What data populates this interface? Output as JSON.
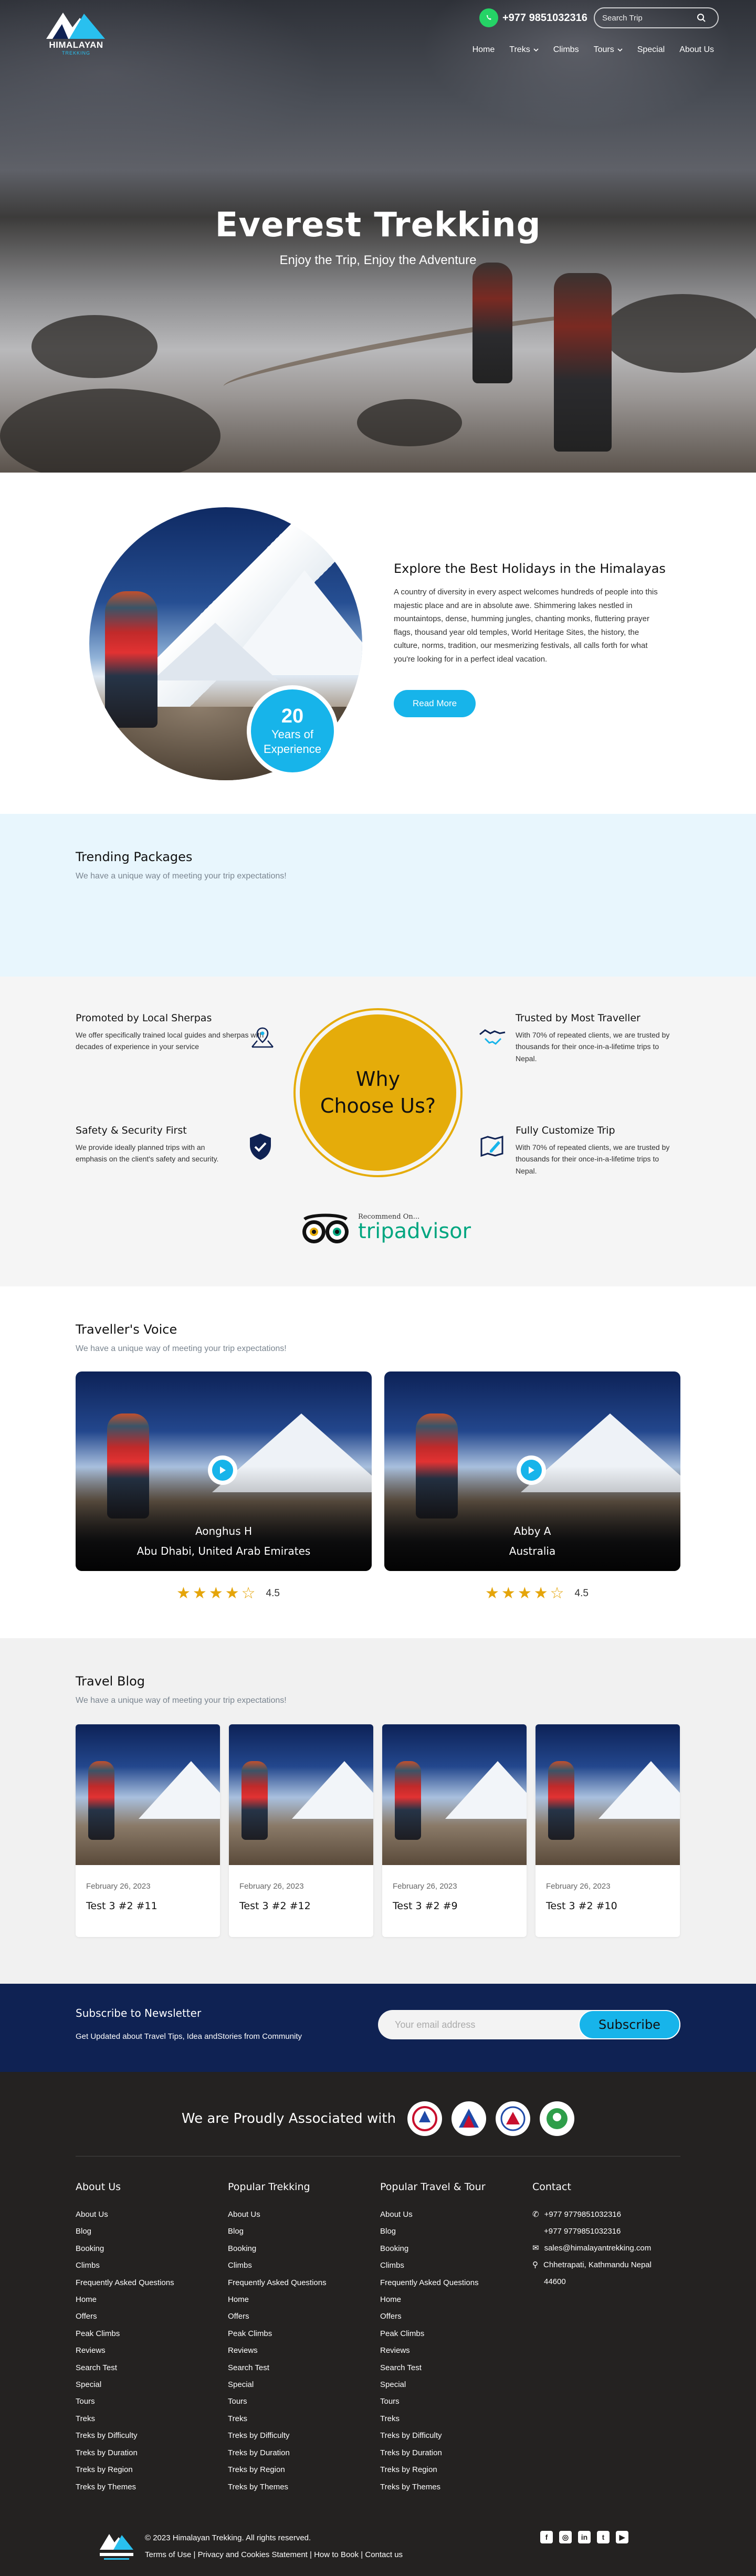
{
  "header": {
    "logo_text": "HIMALAYAN",
    "logo_sub": "TREKKING",
    "phone": "+977 9851032316",
    "search_placeholder": "Search Trip",
    "nav": [
      "Home",
      "Treks",
      "Climbs",
      "Tours",
      "Special",
      "About Us"
    ]
  },
  "hero": {
    "title": "Everest Trekking",
    "subtitle": "Enjoy the Trip, Enjoy the Adventure"
  },
  "explore": {
    "badge_number": "20",
    "badge_text_1": "Years of",
    "badge_text_2": "Experience",
    "title": "Explore the Best Holidays in the Himalayas",
    "body": "A country of diversity in every aspect welcomes hundreds of people into this majestic place and are in absolute awe. Shimmering lakes nestled in mountaintops, dense, humming jungles, chanting monks, fluttering prayer flags, thousand year old temples, World Heritage Sites, the history, the culture, norms, tradition, our mesmerizing festivals, all calls forth for what you're looking for in a perfect ideal vacation.",
    "button": "Read More"
  },
  "trending": {
    "title": "Trending Packages",
    "subtitle": "We have a unique way of meeting your trip expectations!"
  },
  "why": {
    "circle_line1": "Why",
    "circle_line2": "Choose Us?",
    "features": [
      {
        "title": "Promoted by Local Sherpas",
        "text": "We offer specifically trained local guides and sherpas with decades of experience in your service",
        "icon": "map-pin-icon"
      },
      {
        "title": "Trusted by Most Traveller",
        "text": "With 70% of repeated clients, we are trusted by thousands for their once-in-a-lifetime trips to Nepal.",
        "icon": "handshake-icon"
      },
      {
        "title": "Safety & Security First",
        "text": "We provide ideally planned trips with an emphasis on the client's safety and security.",
        "icon": "shield-check-icon"
      },
      {
        "title": "Fully Customize Trip",
        "text": "With 70% of repeated clients, we are trusted by thousands for their once-in-a-lifetime trips to Nepal.",
        "icon": "map-edit-icon"
      }
    ],
    "recommended": "Recommend On...",
    "tripadvisor": "tripadvisor"
  },
  "voice": {
    "title": "Traveller's Voice",
    "subtitle": "We have a unique way of meeting your trip expectations!",
    "cards": [
      {
        "name": "Aonghus H",
        "place": "Abu Dhabi, United Arab Emirates",
        "rating": 4.5,
        "score": "4.5"
      },
      {
        "name": "Abby A",
        "place": "Australia",
        "rating": 4.5,
        "score": "4.5"
      }
    ]
  },
  "blog": {
    "title": "Travel Blog",
    "subtitle": "We have a unique way of meeting your trip expectations!",
    "posts": [
      {
        "date": "February 26, 2023",
        "title": "Test 3 #2 #11"
      },
      {
        "date": "February 26, 2023",
        "title": "Test 3 #2 #12"
      },
      {
        "date": "February 26, 2023",
        "title": "Test 3 #2 #9"
      },
      {
        "date": "February 26, 2023",
        "title": "Test 3 #2 #10"
      }
    ]
  },
  "newsletter": {
    "title": "Subscribe to Newsletter",
    "subtitle": "Get Updated about Travel Tips, Idea andStories from Community",
    "placeholder": "Your email address",
    "button": "Subscribe"
  },
  "footer": {
    "assoc_title": "We are Proudly Associated with",
    "columns": [
      {
        "title": "About Us",
        "links": [
          "About Us",
          "Blog",
          "Booking",
          "Climbs",
          "Frequently Asked Questions",
          "Home",
          "Offers",
          "Peak Climbs",
          "Reviews",
          "Search Test",
          "Special",
          "Tours",
          "Treks",
          "Treks by Difficulty",
          "Treks by Duration",
          "Treks by Region",
          "Treks by Themes"
        ]
      },
      {
        "title": "Popular Trekking",
        "links": [
          "About Us",
          "Blog",
          "Booking",
          "Climbs",
          "Frequently Asked Questions",
          "Home",
          "Offers",
          "Peak Climbs",
          "Reviews",
          "Search Test",
          "Special",
          "Tours",
          "Treks",
          "Treks by Difficulty",
          "Treks by Duration",
          "Treks by Region",
          "Treks by Themes"
        ]
      },
      {
        "title": "Popular Travel & Tour",
        "links": [
          "About Us",
          "Blog",
          "Booking",
          "Climbs",
          "Frequently Asked Questions",
          "Home",
          "Offers",
          "Peak Climbs",
          "Reviews",
          "Search Test",
          "Special",
          "Tours",
          "Treks",
          "Treks by Difficulty",
          "Treks by Duration",
          "Treks by Region",
          "Treks by Themes"
        ]
      }
    ],
    "contact": {
      "title": "Contact",
      "phone1": "+977 9779851032316",
      "phone2": "+977 9779851032316",
      "email": "sales@himalayantrekking.com",
      "address1": "Chhetrapati, Kathmandu Nepal",
      "address2": "44600"
    },
    "copyright": "© 2023 Himalayan Trekking. All rights reserved.",
    "legal": "Terms of Use | Privacy and Cookies Statement | How to Book | Contact us",
    "social": [
      "facebook-icon",
      "instagram-icon",
      "linkedin-icon",
      "twitter-icon",
      "youtube-icon"
    ]
  },
  "colors": {
    "accent": "#17b4ea",
    "gold": "#e5ac0a",
    "navy": "#0f2253",
    "footer": "#242221",
    "star": "#e5a50a"
  }
}
